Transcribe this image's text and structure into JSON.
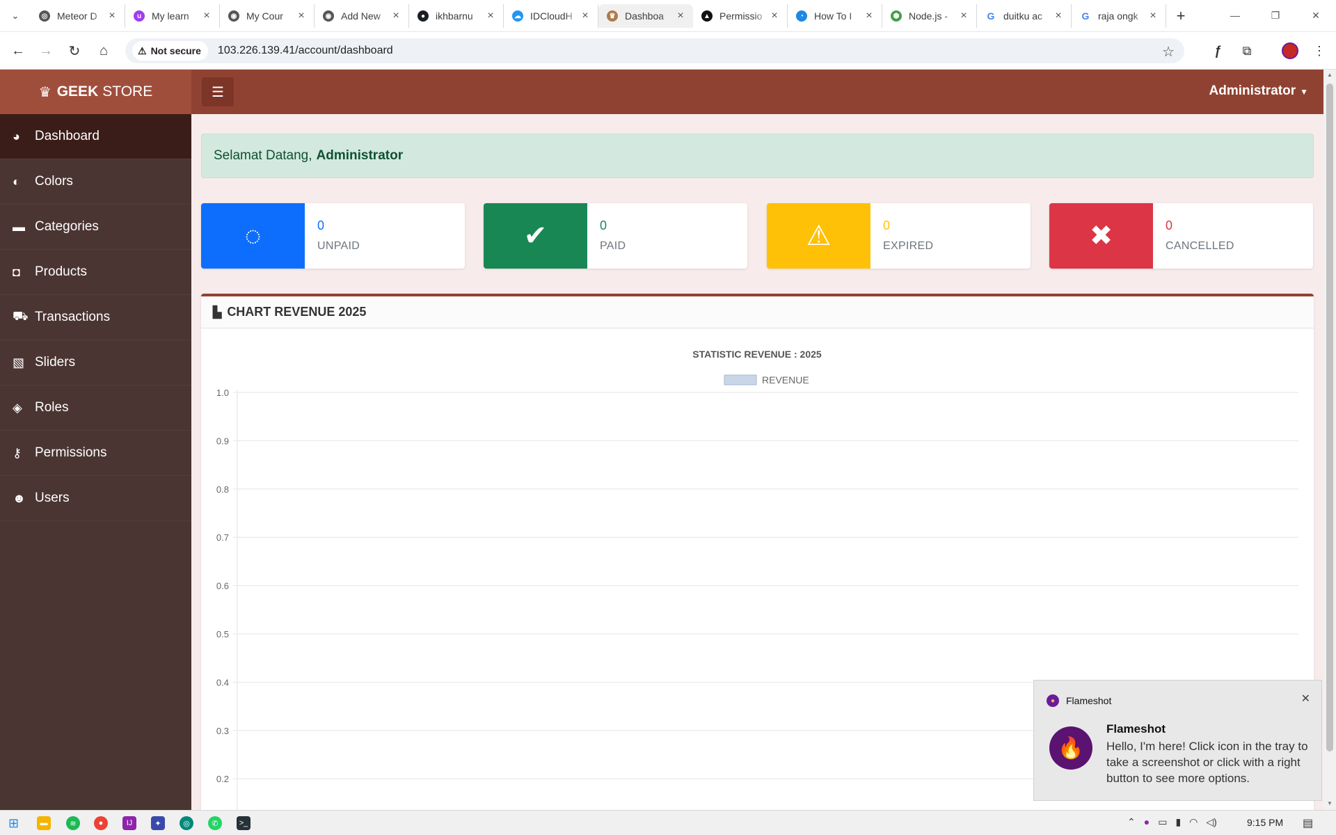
{
  "browser": {
    "tabs": [
      {
        "title": "Meteor D",
        "favicon_color": "#555555",
        "favicon_glyph": "◎",
        "icon_name": "meteor-icon"
      },
      {
        "title": "My learn",
        "favicon_color": "#a13cf0",
        "favicon_glyph": "u",
        "icon_name": "udemy-icon"
      },
      {
        "title": "My Cour",
        "favicon_color": "#555555",
        "favicon_glyph": "◉",
        "icon_name": "course-icon"
      },
      {
        "title": "Add New",
        "favicon_color": "#555555",
        "favicon_glyph": "◉",
        "icon_name": "course-icon"
      },
      {
        "title": "ikhbarnu",
        "favicon_color": "#1b1f23",
        "favicon_glyph": "●",
        "icon_name": "github-icon"
      },
      {
        "title": "IDCloudH",
        "favicon_color": "#2196f3",
        "favicon_glyph": "☁",
        "icon_name": "cloud-icon"
      },
      {
        "title": "Dashboa",
        "favicon_color": "#b07a4a",
        "favicon_glyph": "♛",
        "icon_name": "geek-store-icon",
        "active": true
      },
      {
        "title": "Permissio",
        "favicon_color": "#111111",
        "favicon_glyph": "▲",
        "icon_name": "permission-site-icon"
      },
      {
        "title": "How To I",
        "favicon_color": "#1e88e5",
        "favicon_glyph": "◔",
        "icon_name": "howto-site-icon"
      },
      {
        "title": "Node.js -",
        "favicon_color": "#43a047",
        "favicon_glyph": "⬢",
        "icon_name": "nodejs-icon"
      },
      {
        "title": "duitku ac",
        "favicon_color": "#ffffff",
        "favicon_glyph": "G",
        "icon_name": "google-icon"
      },
      {
        "title": "raja ongk",
        "favicon_color": "#ffffff",
        "favicon_glyph": "G",
        "icon_name": "google-icon"
      }
    ],
    "security_label": "Not secure",
    "url": "103.226.139.41/account/dashboard"
  },
  "app": {
    "brand_bold": "GEEK",
    "brand_rest": "STORE",
    "user_name": "Administrator"
  },
  "sidebar": {
    "items": [
      {
        "label": "Dashboard",
        "icon": "dashboard-icon",
        "glyph": "◕",
        "active": true
      },
      {
        "label": "Colors",
        "icon": "palette-icon",
        "glyph": "◐"
      },
      {
        "label": "Categories",
        "icon": "folder-icon",
        "glyph": "▬"
      },
      {
        "label": "Products",
        "icon": "shopping-bag-icon",
        "glyph": "◘"
      },
      {
        "label": "Transactions",
        "icon": "cart-icon",
        "glyph": "⛟"
      },
      {
        "label": "Sliders",
        "icon": "images-icon",
        "glyph": "▧"
      },
      {
        "label": "Roles",
        "icon": "shield-icon",
        "glyph": "◈"
      },
      {
        "label": "Permissions",
        "icon": "key-icon",
        "glyph": "⚷"
      },
      {
        "label": "Users",
        "icon": "users-icon",
        "glyph": "☻"
      }
    ]
  },
  "welcome": {
    "prefix": "Selamat Datang,",
    "name": "Administrator"
  },
  "stats": [
    {
      "value": "0",
      "label": "UNPAID",
      "color": "#0d6efd",
      "icon": "spinner-icon",
      "glyph": "◌"
    },
    {
      "value": "0",
      "label": "PAID",
      "color": "#198754",
      "icon": "check-circle-icon",
      "glyph": "✔"
    },
    {
      "value": "0",
      "label": "EXPIRED",
      "color": "#ffc107",
      "icon": "warning-icon",
      "glyph": "⚠"
    },
    {
      "value": "0",
      "label": "CANCELLED",
      "color": "#dc3545",
      "icon": "times-icon",
      "glyph": "✖"
    }
  ],
  "chart_card": {
    "header": "CHART REVENUE 2025"
  },
  "chart_data": {
    "type": "bar",
    "title": "STATISTIC REVENUE : 2025",
    "series": [
      {
        "name": "REVENUE",
        "values": []
      }
    ],
    "categories": [],
    "y_ticks": [
      "1.0",
      "0.9",
      "0.8",
      "0.7",
      "0.6",
      "0.5",
      "0.4",
      "0.3",
      "0.2"
    ],
    "ylim": [
      0,
      1.0
    ],
    "legend": "top-center",
    "grid": true,
    "colors": {
      "series": "#c9d6e8"
    }
  },
  "toast": {
    "app": "Flameshot",
    "title": "Flameshot",
    "message": "Hello, I'm here! Click icon in the tray to take a screenshot or click with a right button to see more options."
  },
  "taskbar": {
    "time": "9:15 PM"
  }
}
